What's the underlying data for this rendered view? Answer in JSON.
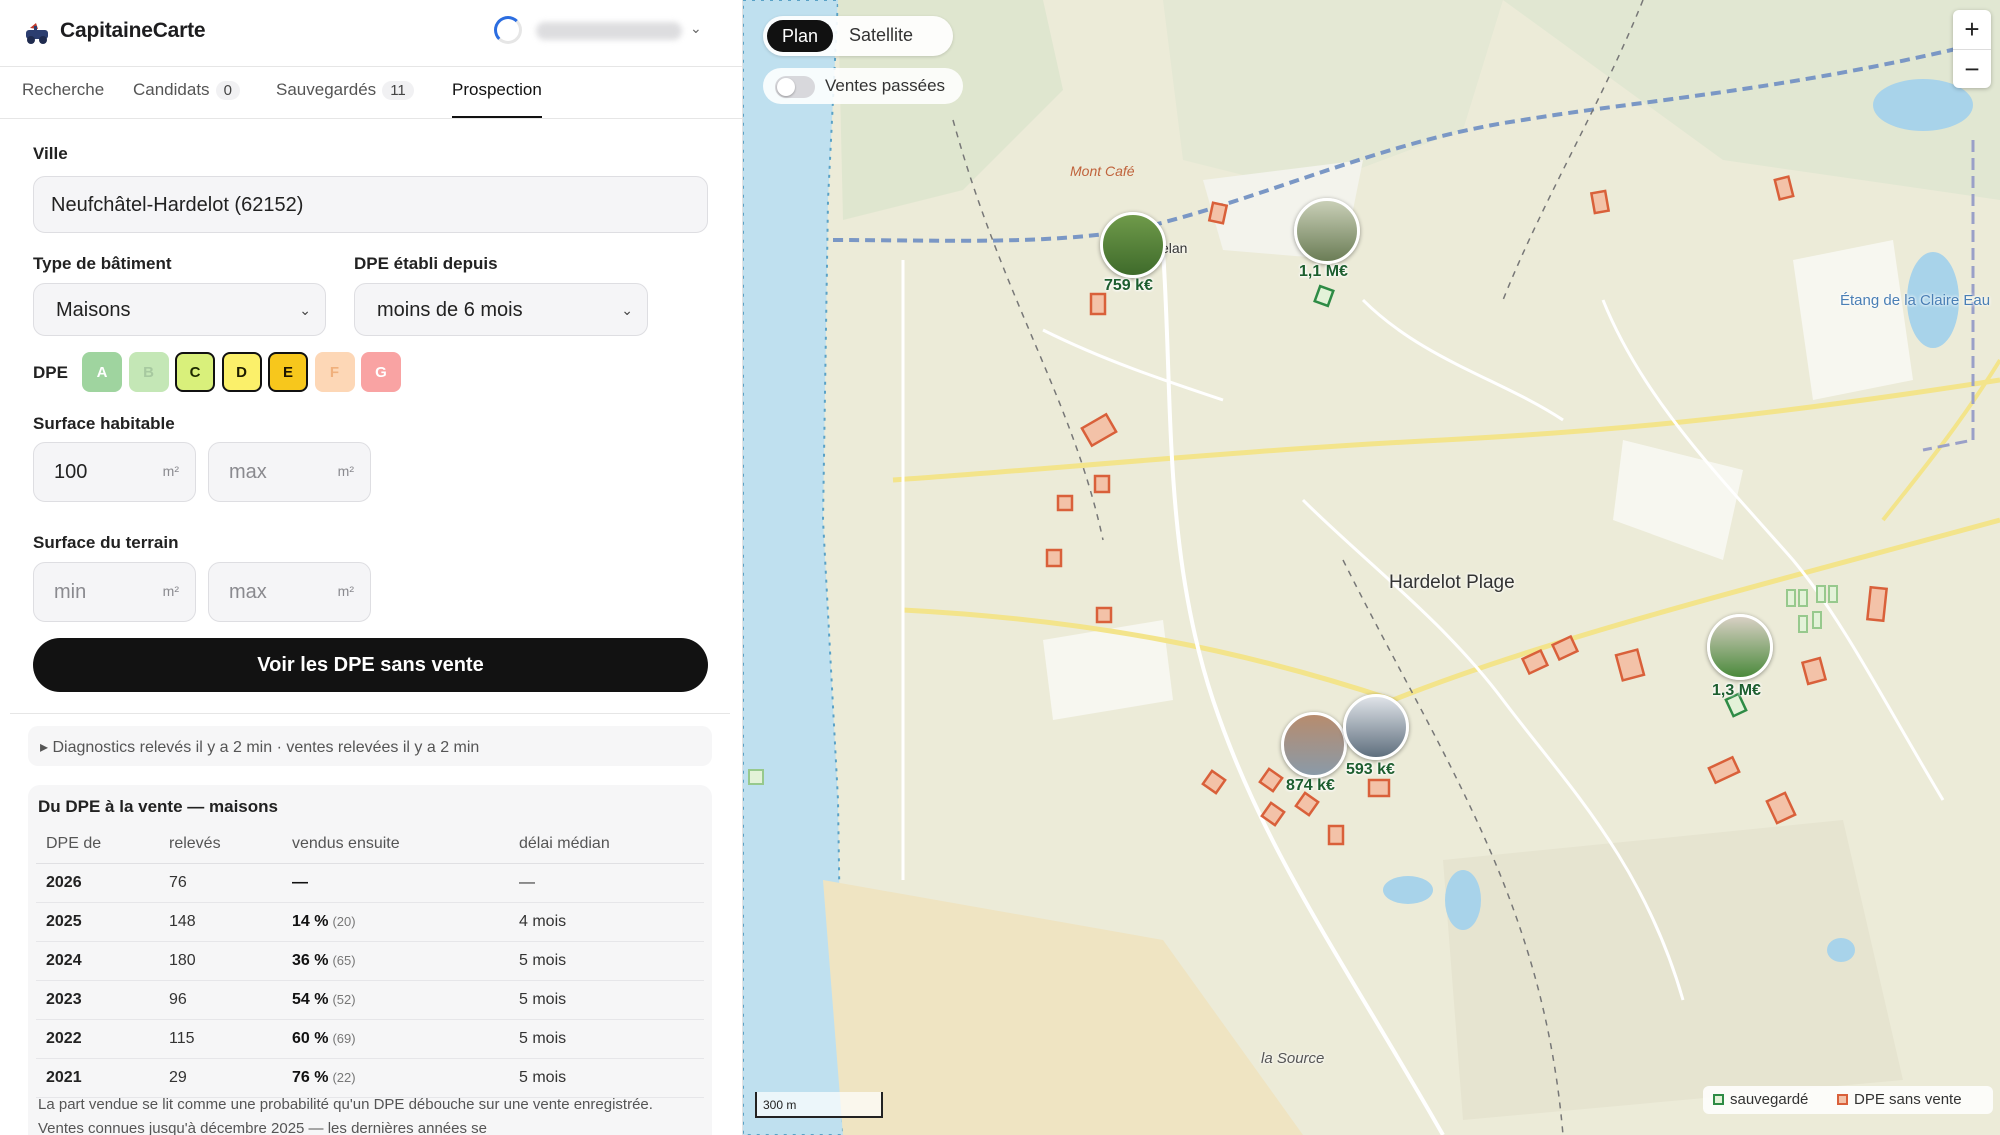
{
  "app": {
    "title": "CapitaineCarte"
  },
  "tabs": [
    {
      "label": "Recherche",
      "count": ""
    },
    {
      "label": "Candidats",
      "count": "0"
    },
    {
      "label": "Sauvegardés",
      "count": "11"
    },
    {
      "label": "Prospection",
      "count": ""
    }
  ],
  "form": {
    "city_label": "Ville",
    "city_value": "Neufchâtel-Hardelot (62152)",
    "building_type_label": "Type de bâtiment",
    "building_type_value": "Maisons",
    "dpe_since_label": "DPE établi depuis",
    "dpe_since_value": "moins de 6 mois",
    "dpe_label": "DPE",
    "dpe_classes": [
      {
        "letter": "A",
        "bg": "#9fd49f",
        "fg": "#ffffff",
        "selected": false
      },
      {
        "letter": "B",
        "bg": "#c4e7b6",
        "fg": "#a7c9a0",
        "selected": false
      },
      {
        "letter": "C",
        "bg": "#d9f07b",
        "fg": "#1d2a00",
        "selected": true
      },
      {
        "letter": "D",
        "bg": "#fbf06a",
        "fg": "#1d1d00",
        "selected": true
      },
      {
        "letter": "E",
        "bg": "#f7c71c",
        "fg": "#1d1400",
        "selected": true
      },
      {
        "letter": "F",
        "bg": "#fdd7b6",
        "fg": "#f0b07c",
        "selected": false
      },
      {
        "letter": "G",
        "bg": "#f9a3a3",
        "fg": "#ffffff",
        "selected": false
      }
    ],
    "surface_label": "Surface habitable",
    "surface_min": "100",
    "surface_max_placeholder": "max",
    "land_label": "Surface du terrain",
    "land_min_placeholder": "min",
    "land_max_placeholder": "max",
    "unit": "m²",
    "cta": "Voir les DPE sans vente"
  },
  "details": "▸ Diagnostics relevés il y a 2 min · ventes relevées il y a 2 min",
  "stats": {
    "title": "Du DPE à la vente — maisons",
    "headers": [
      "DPE de",
      "relevés",
      "vendus ensuite",
      "délai médian"
    ],
    "rows": [
      {
        "year": "2026",
        "count": "76",
        "pct": "—",
        "n": "",
        "delay": "—"
      },
      {
        "year": "2025",
        "count": "148",
        "pct": "14 %",
        "n": "(20)",
        "delay": "4 mois"
      },
      {
        "year": "2024",
        "count": "180",
        "pct": "36 %",
        "n": "(65)",
        "delay": "5 mois"
      },
      {
        "year": "2023",
        "count": "96",
        "pct": "54 %",
        "n": "(52)",
        "delay": "5 mois"
      },
      {
        "year": "2022",
        "count": "115",
        "pct": "60 %",
        "n": "(69)",
        "delay": "5 mois"
      },
      {
        "year": "2021",
        "count": "29",
        "pct": "76 %",
        "n": "(22)",
        "delay": "5 mois"
      }
    ],
    "note": "La part vendue se lit comme une probabilité qu'un DPE débouche sur une vente enregistrée. Ventes connues jusqu'à décembre 2025 — les dernières années se"
  },
  "map": {
    "mode_plan": "Plan",
    "mode_satellite": "Satellite",
    "past_sales_label": "Ventes passées",
    "zoom_in": "+",
    "zoom_out": "−",
    "places": {
      "main": "Hardelot Plage",
      "lake": "Étang de la Claire Eau",
      "source": "la Source",
      "cafe": "Mont Café",
      "elan": "elan"
    },
    "markers": [
      {
        "price": "759 k€"
      },
      {
        "price": "1,1 M€"
      },
      {
        "price": "874 k€"
      },
      {
        "price": "593 k€"
      },
      {
        "price": "1,3 M€"
      }
    ],
    "legend": {
      "saved": "sauvegardé",
      "dpe_no_sale": "DPE sans vente"
    },
    "scale": "300 m",
    "colors": {
      "saved": "#2e8b45",
      "dpe_no_sale": "#d9603a"
    }
  }
}
